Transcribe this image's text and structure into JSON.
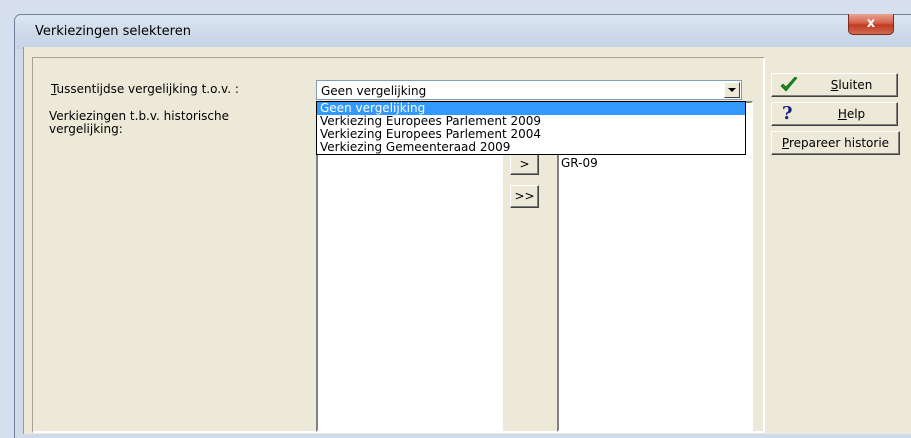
{
  "window": {
    "title": "Verkiezingen selekteren",
    "close_glyph": "x"
  },
  "labels": {
    "tussentijdse_hotkey": "T",
    "tussentijdse_rest": "ussentijdse vergelijking t.o.v. :",
    "historisch_line1": "Verkiezingen t.b.v. historische",
    "historisch_line2": "vergelijking:"
  },
  "combo": {
    "value": "Geen vergelijking",
    "options": [
      "Geen vergelijking",
      "Verkiezing Europees Parlement 2009",
      "Verkiezing Europees Parlement 2004",
      "Verkiezing Gemeenteraad 2009"
    ],
    "selected_index": 0
  },
  "transfer": {
    "add_label": ">",
    "add_all_label": ">>"
  },
  "right_list": {
    "items": [
      "GR-09"
    ]
  },
  "buttons": {
    "sluiten": {
      "hotkey": "S",
      "rest": "luiten",
      "icon": "check-icon"
    },
    "help": {
      "hotkey": "H",
      "rest": "elp",
      "icon": "help-icon",
      "glyph": "?"
    },
    "prepareer": {
      "hotkey": "P",
      "rest": "repareer historie"
    }
  },
  "colors": {
    "selection": "#3399ff",
    "check": "#1a8a1a",
    "close_button": "#c23a20"
  }
}
